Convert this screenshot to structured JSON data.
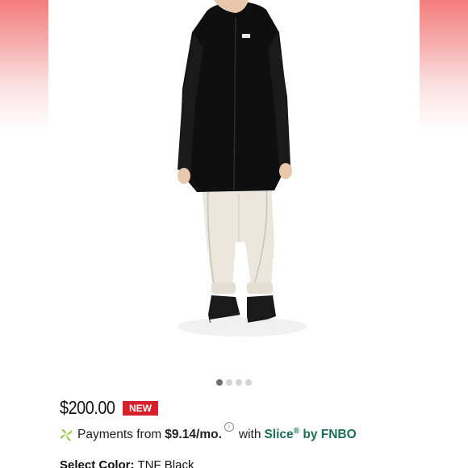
{
  "product": {
    "image_alt": "Black hooded long parka with white wide-leg pants and black sneakers",
    "gallery": {
      "count": 4,
      "active_index": 0
    },
    "price": "$200.00",
    "badge": "NEW"
  },
  "payment": {
    "prefix": "Payments from",
    "amount": "$9.14/mo.",
    "info_icon": "i",
    "with": "with",
    "brand": "Slice",
    "reg": "®",
    "by": "by FNBO"
  },
  "color_select": {
    "label": "Select Color:",
    "value": "TNF Black"
  },
  "colors": {
    "badge": "#d6202b",
    "slice_green": "#1c6e57",
    "leaf_green": "#8cc63f"
  }
}
